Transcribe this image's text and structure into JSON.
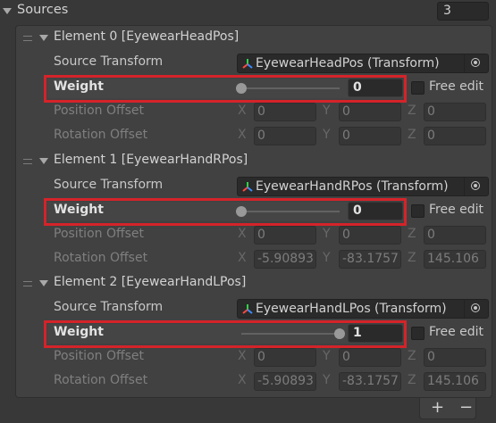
{
  "header": {
    "title": "Sources",
    "count": "3"
  },
  "elements": [
    {
      "title": "Element 0 [EyewearHeadPos]",
      "source_label": "Source Transform",
      "source_value": "EyewearHeadPos (Transform)",
      "weight_label": "Weight",
      "weight_value": "0",
      "weight_fraction": 0,
      "free_edit": "Free edit",
      "position_label": "Position Offset",
      "rotation_label": "Rotation Offset",
      "pos": {
        "x": "0",
        "y": "0",
        "z": "0"
      },
      "rot": {
        "x": "0",
        "y": "0",
        "z": "0"
      }
    },
    {
      "title": "Element 1 [EyewearHandRPos]",
      "source_label": "Source Transform",
      "source_value": "EyewearHandRPos (Transform)",
      "weight_label": "Weight",
      "weight_value": "0",
      "weight_fraction": 0,
      "free_edit": "Free edit",
      "position_label": "Position Offset",
      "rotation_label": "Rotation Offset",
      "pos": {
        "x": "0",
        "y": "0",
        "z": "0"
      },
      "rot": {
        "x": "-5.90893",
        "y": "-83.1757",
        "z": "145.106"
      }
    },
    {
      "title": "Element 2 [EyewearHandLPos]",
      "source_label": "Source Transform",
      "source_value": "EyewearHandLPos (Transform)",
      "weight_label": "Weight",
      "weight_value": "1",
      "weight_fraction": 1,
      "free_edit": "Free edit",
      "position_label": "Position Offset",
      "rotation_label": "Rotation Offset",
      "pos": {
        "x": "0",
        "y": "0",
        "z": "0"
      },
      "rot": {
        "x": "-5.90893",
        "y": "-83.1757",
        "z": "145.106"
      }
    }
  ],
  "axes": {
    "x": "X",
    "y": "Y",
    "z": "Z"
  },
  "footer": {
    "add": "+",
    "remove": "−"
  },
  "colors": {
    "highlight": "#d5232a",
    "background": "#383838",
    "transform_icon": [
      "#ff4a3d",
      "#2fd24a",
      "#3b8cff"
    ]
  },
  "icons": {
    "foldout": "triangle-down-icon",
    "drag": "drag-handle-icon",
    "transform": "transform-axis-icon",
    "picker": "object-picker-icon"
  }
}
